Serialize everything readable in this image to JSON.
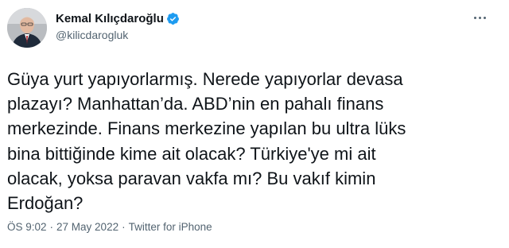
{
  "user": {
    "display_name": "Kemal Kılıçdaroğlu",
    "handle": "@kilicdarogluk",
    "verified": true
  },
  "tweet": {
    "text": "Güya yurt yapıyorlarmış. Nerede yapıyorlar devasa\nplazayı? Manhattan’da. ABD’nin en pahalı finans\nmerkezinde. Finans merkezine yapılan bu ultra lüks\nbina bittiğinde kime ait olacak? Türkiye'ye mi ait\nolacak, yoksa paravan vakfa mı? Bu vakıf kimin\nErdoğan?",
    "time": "ÖS 9:02",
    "date": "27 May 2022",
    "source": "Twitter for iPhone",
    "separator": "·"
  },
  "icons": {
    "verified": "verified-badge-icon",
    "more": "more-options-icon"
  },
  "colors": {
    "text_primary": "#0f1419",
    "text_secondary": "#536471",
    "verified_blue": "#1d9bf0",
    "background": "#ffffff"
  }
}
